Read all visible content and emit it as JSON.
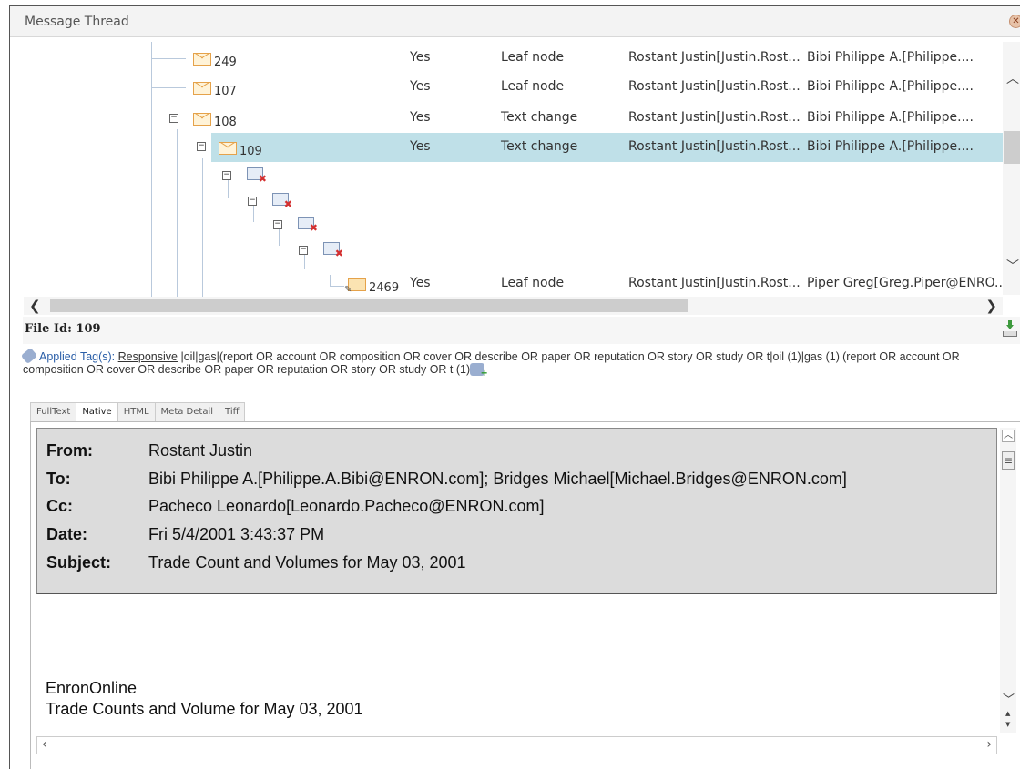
{
  "window": {
    "title": "Message Thread"
  },
  "thread": {
    "rows": [
      {
        "id": "249",
        "has_attach": "Yes",
        "type": "Leaf node",
        "from": "Rostant Justin[Justin.Rost...",
        "to": "Bibi Philippe A.[Philippe...."
      },
      {
        "id": "107",
        "has_attach": "Yes",
        "type": "Leaf node",
        "from": "Rostant Justin[Justin.Rost...",
        "to": "Bibi Philippe A.[Philippe...."
      },
      {
        "id": "108",
        "has_attach": "Yes",
        "type": "Text change",
        "from": "Rostant Justin[Justin.Rost...",
        "to": "Bibi Philippe A.[Philippe...."
      },
      {
        "id": "109",
        "has_attach": "Yes",
        "type": "Text change",
        "from": "Rostant Justin[Justin.Rost...",
        "to": "Bibi Philippe A.[Philippe....",
        "selected": true
      },
      {
        "id": "2469",
        "has_attach": "Yes",
        "type": "Leaf node",
        "from": "Rostant Justin[Justin.Rost...",
        "to": "Piper Greg[Greg.Piper@ENRO..."
      }
    ]
  },
  "file": {
    "id_label": "File Id: 109"
  },
  "tags": {
    "label": "Applied Tag(s):",
    "tag_name": "Responsive",
    "rest": " |oil|gas|(report OR account OR composition OR cover OR describe OR paper OR reputation OR story OR study OR t|oil (1)|gas (1)|(report OR account OR composition OR cover OR describe OR paper OR reputation OR story OR study OR t (1)"
  },
  "tabs": [
    "FullText",
    "Native",
    "HTML",
    "Meta Detail",
    "Tiff"
  ],
  "active_tab": "Native",
  "email": {
    "from_label": "From:",
    "from": "Rostant  Justin",
    "to_label": "To:",
    "to": "Bibi  Philippe A.[Philippe.A.Bibi@ENRON.com]; Bridges  Michael[Michael.Bridges@ENRON.com]",
    "cc_label": "Cc:",
    "cc": "Pacheco  Leonardo[Leonardo.Pacheco@ENRON.com]",
    "date_label": "Date:",
    "date": "Fri 5/4/2001 3:43:37 PM",
    "subject_label": "Subject:",
    "subject": "Trade Count and Volumes for May 03, 2001",
    "body_line1": "EnronOnline",
    "body_line2": "Trade Counts and Volume for May 03, 2001"
  },
  "colors": {
    "selected_row": "#bfe0e8",
    "header_bg": "#dcdcdc",
    "tag_label": "#2b5fa8"
  }
}
